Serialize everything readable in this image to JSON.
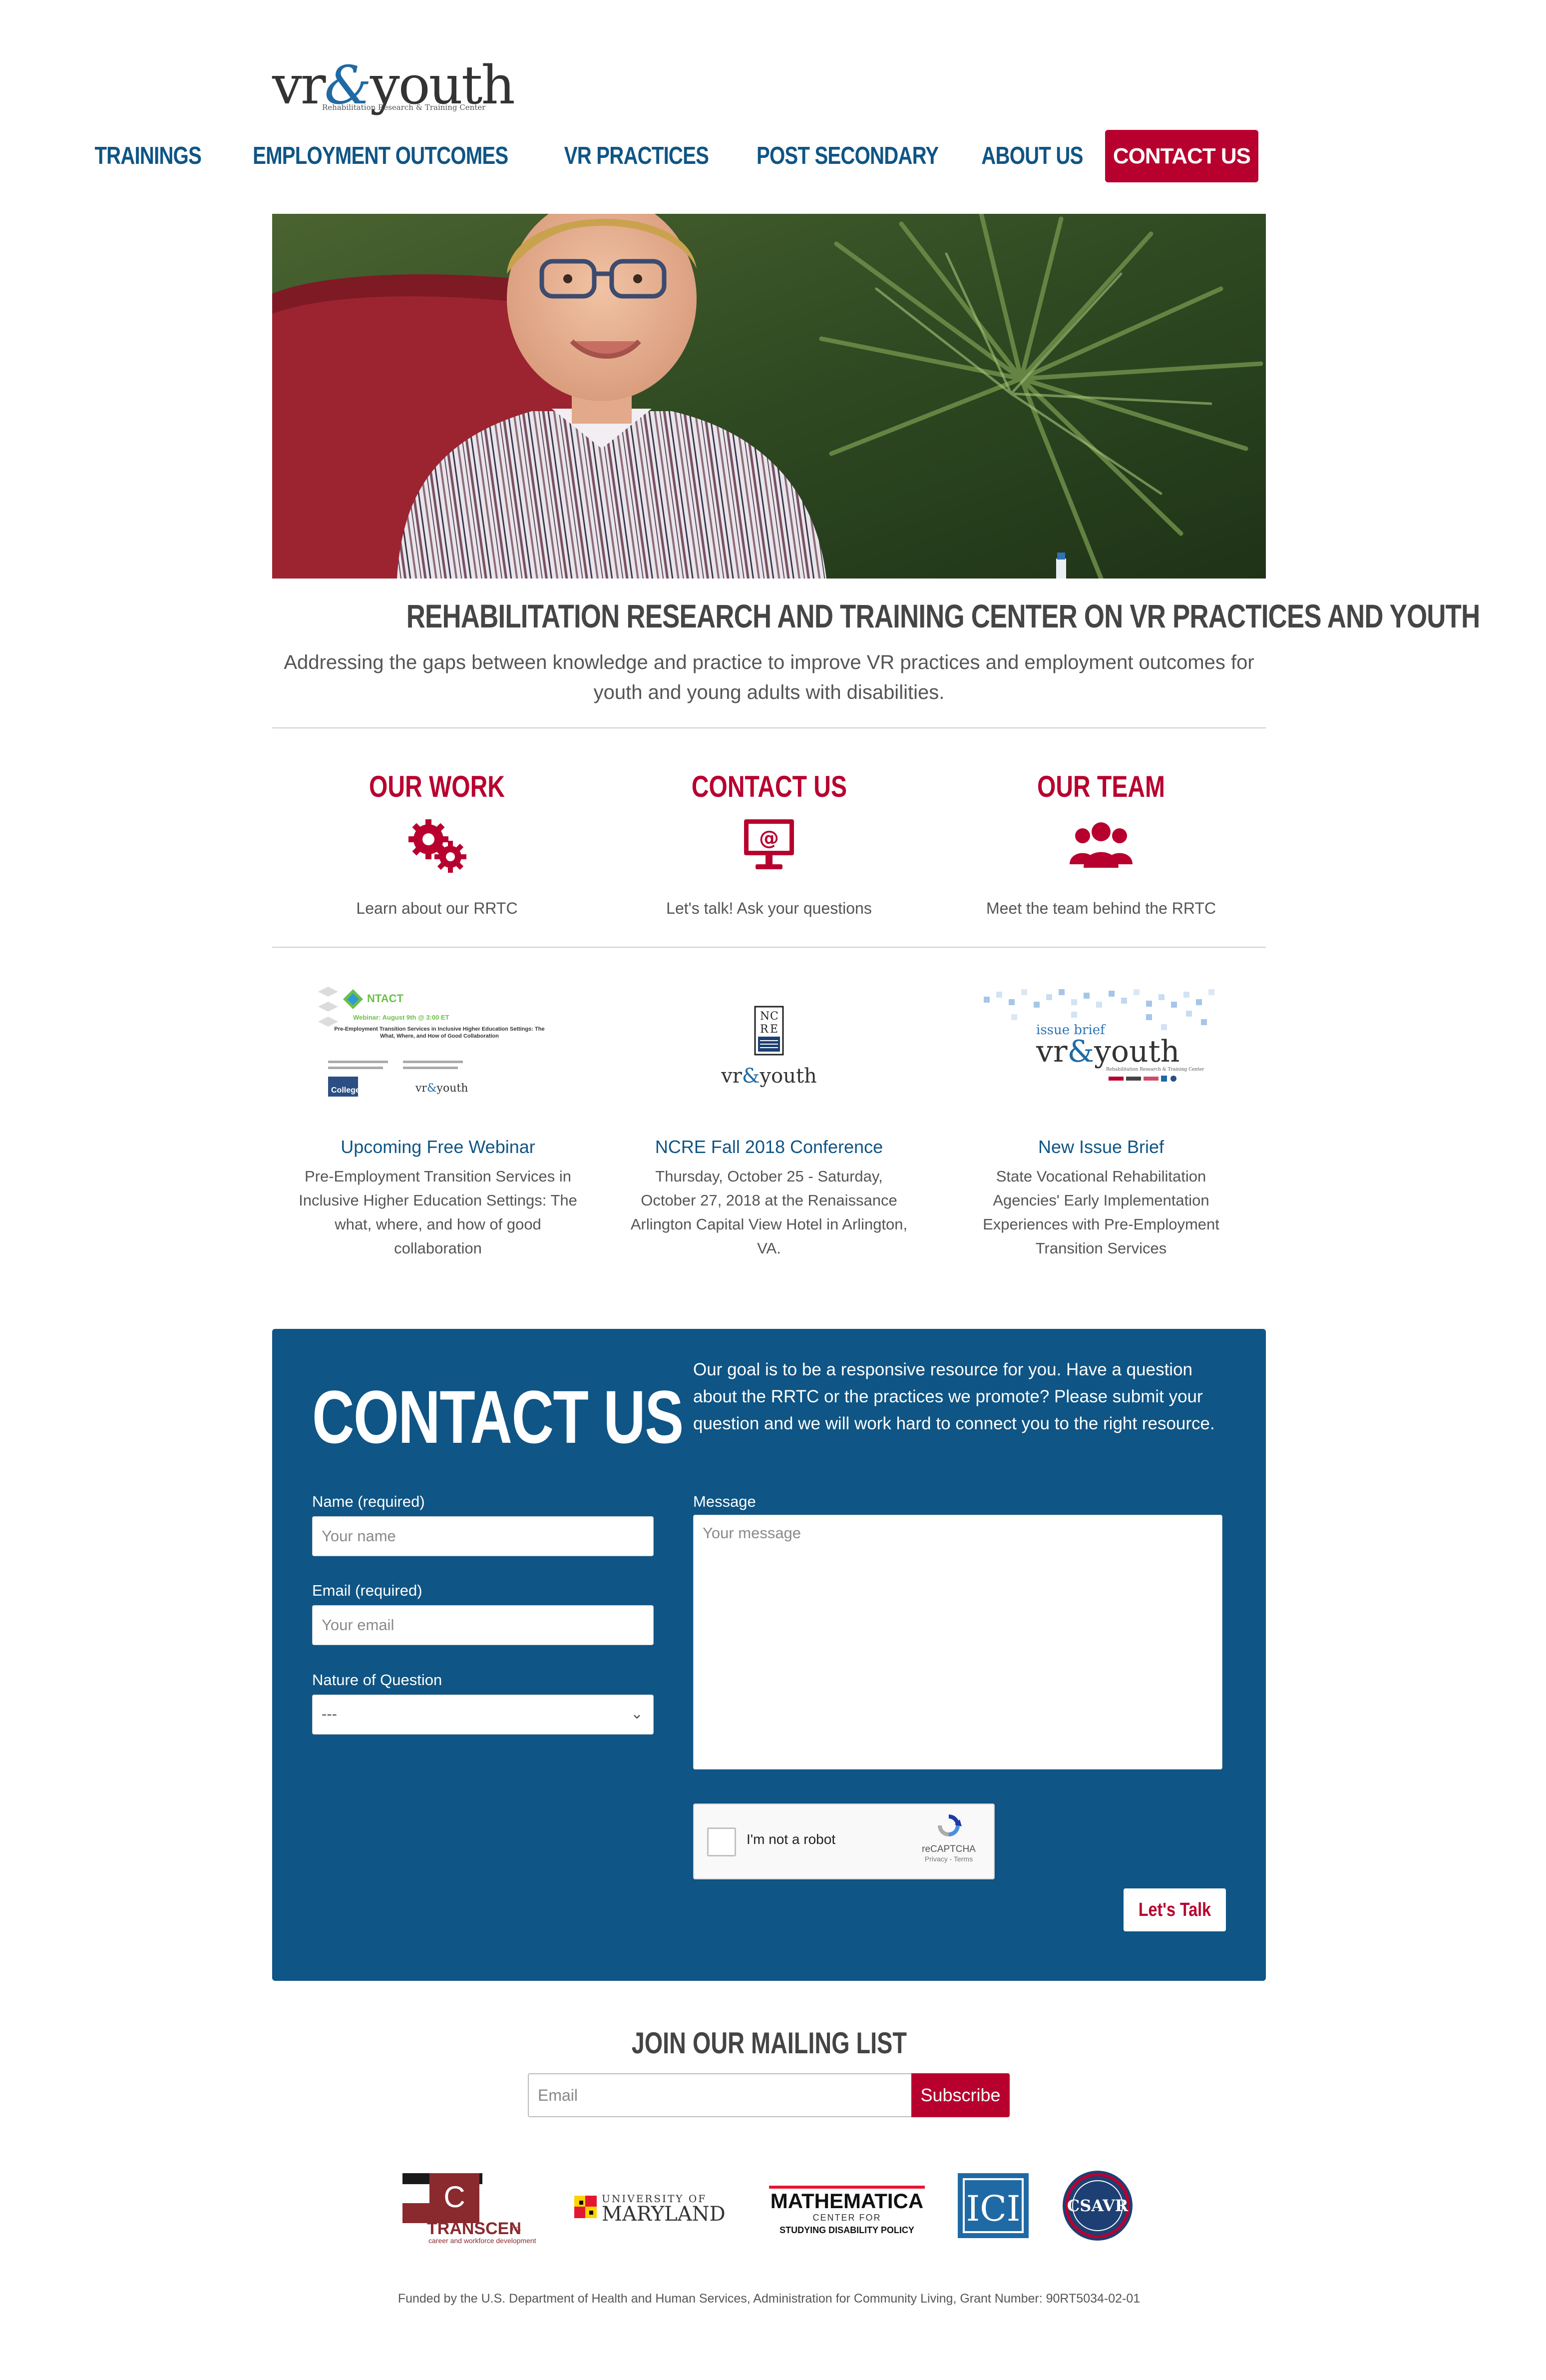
{
  "header": {
    "logo_main_left": "vr",
    "logo_amp": "&",
    "logo_main_right": "youth",
    "logo_sub": "Rehabilitation Research & Training Center"
  },
  "nav": {
    "items": [
      {
        "label": "TRAININGS"
      },
      {
        "label": "EMPLOYMENT OUTCOMES"
      },
      {
        "label": "VR PRACTICES"
      },
      {
        "label": "POST SECONDARY"
      },
      {
        "label": "ABOUT US"
      },
      {
        "label": "CONTACT US",
        "active": true
      }
    ]
  },
  "hero": {
    "title": "REHABILITATION RESEARCH AND TRAINING CENTER ON VR PRACTICES AND YOUTH",
    "subtitle": "Addressing the gaps between knowledge and practice to improve VR practices and employment outcomes for youth and young adults with disabilities."
  },
  "features": [
    {
      "title": "OUR WORK",
      "icon": "gears-icon",
      "desc": "Learn about our RRTC"
    },
    {
      "title": "CONTACT US",
      "icon": "monitor-at-icon",
      "desc": "Let's talk! Ask your questions"
    },
    {
      "title": "OUR TEAM",
      "icon": "team-icon",
      "desc": "Meet the team behind the RRTC"
    }
  ],
  "news": [
    {
      "title": "Upcoming Free Webinar",
      "desc": "Pre-Employment Transition Services in Inclusive Higher Education Settings: The what, where, and how of good collaboration",
      "thumb": {
        "brand": "NTACT",
        "banner": "Webinar: August 9th @ 3:00 ET",
        "heading": "Pre-Employment Transition Services in Inclusive Higher Education Settings: The What, Where, and How of Good Collaboration",
        "college": "College",
        "vr": "vr",
        "amp": "&",
        "youth": "youth"
      }
    },
    {
      "title": "NCRE Fall 2018 Conference",
      "desc": "Thursday, October 25 - Saturday, October 27, 2018 at the Renaissance Arlington Capital View Hotel in Arlington, VA.",
      "thumb": {
        "n": "N",
        "c": "C",
        "r": "R",
        "e": "E",
        "vr": "vr",
        "amp": "&",
        "youth": "youth"
      }
    },
    {
      "title": "New Issue Brief",
      "desc": "State Vocational Rehabilitation Agencies' Early Implementation Experiences with Pre-Employment Transition Services",
      "thumb": {
        "label": "issue brief",
        "vr": "vr",
        "amp": "&",
        "youth": "youth",
        "sub": "Rehabilitation Research & Training Center"
      }
    }
  ],
  "contact": {
    "heading": "CONTACT US",
    "intro": "Our goal is to be a responsive resource for you. Have a question about the RRTC or the practices we promote? Please submit your question and we will work hard to connect you to the right resource.",
    "name_label": "Name (required)",
    "name_placeholder": "Your name",
    "email_label": "Email (required)",
    "email_placeholder": "Your email",
    "nature_label": "Nature of Question",
    "nature_value": "---",
    "message_label": "Message",
    "message_placeholder": "Your message",
    "captcha_label": "I'm not a robot",
    "captcha_brand": "reCAPTCHA",
    "captcha_links": "Privacy - Terms",
    "submit_label": "Let's Talk"
  },
  "mailing": {
    "title": "JOIN OUR MAILING LIST",
    "placeholder": "Email",
    "button": "Subscribe"
  },
  "partners": {
    "transcen_c": "C",
    "transcen_name": "TRANSCEN",
    "transcen_inc": "inc.",
    "transcen_tag": "career and workforce development",
    "umd_top": "UNIVERSITY OF",
    "umd_name": "MARYLAND",
    "math_name": "MATHEMATICA",
    "math_center": "CENTER FOR",
    "math_tag": "STUDYING DISABILITY POLICY",
    "ici": "ICI",
    "csavr": "CSAVR"
  },
  "footer": {
    "note": "Funded by the U.S. Department of Health and Human Services, Administration for Community Living, Grant Number: 90RT5034-02-01"
  },
  "colors": {
    "brand_blue": "#0f5585",
    "brand_red": "#b8002f",
    "divider": "#c6d0da"
  }
}
